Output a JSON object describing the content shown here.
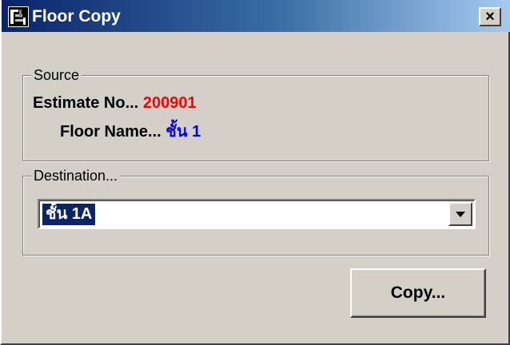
{
  "window": {
    "title": "Floor Copy",
    "close_glyph": "×",
    "icon": "app-icon"
  },
  "source": {
    "label": "Source",
    "estimate_label": "Estimate No...",
    "estimate_value": "200901",
    "floor_label": "Floor Name...",
    "floor_value": "ชั้น 1"
  },
  "destination": {
    "label": "Destination...",
    "selected_value": "ชั้น 1A"
  },
  "actions": {
    "copy_label": "Copy..."
  },
  "colors": {
    "estimate_value": "#ff0000",
    "floor_value": "#0000ff",
    "title_bar": "#0a246a"
  }
}
